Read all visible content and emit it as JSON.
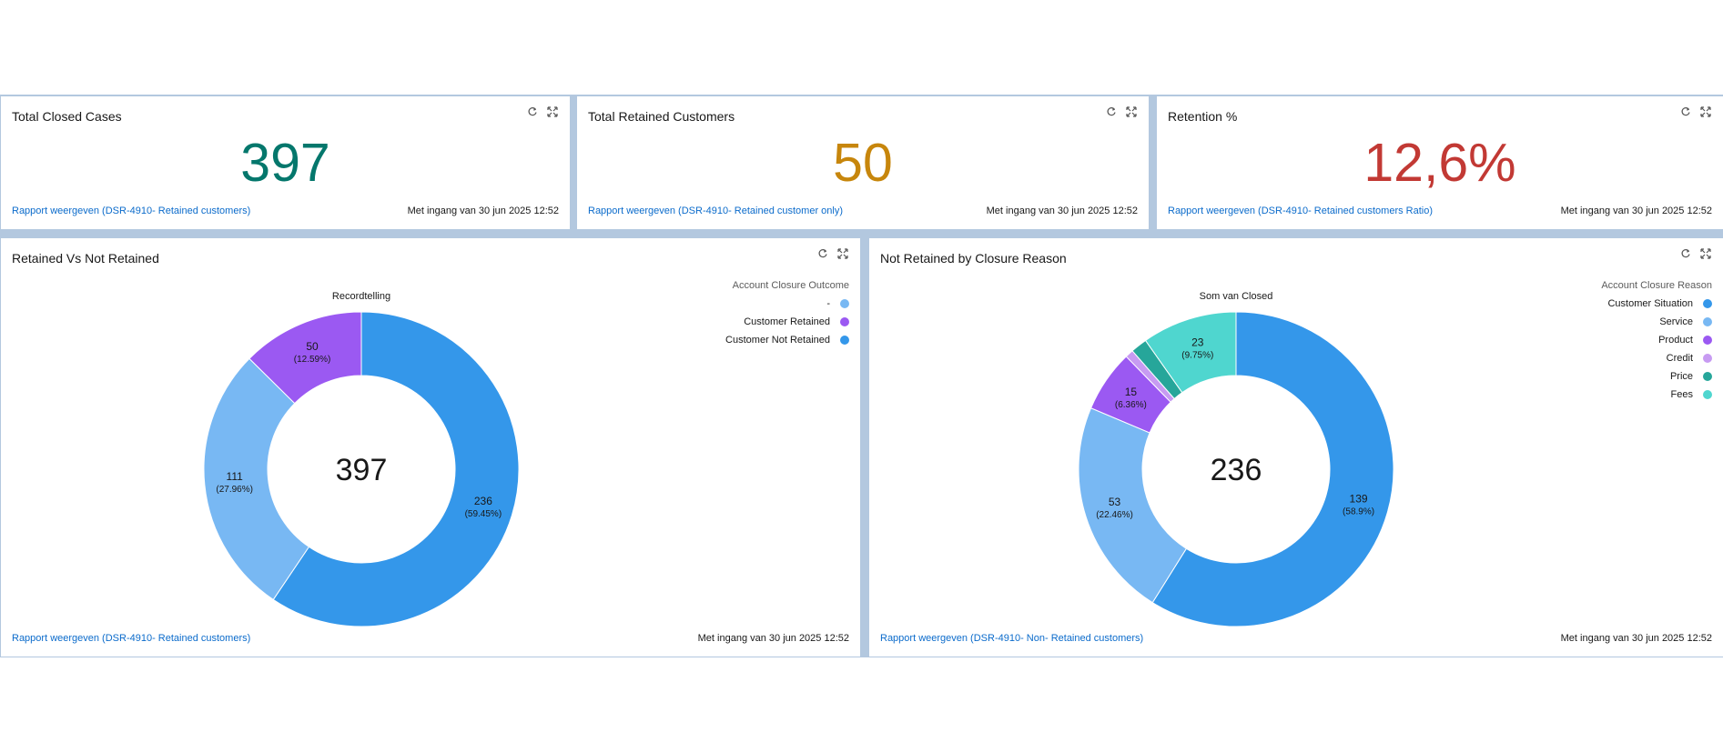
{
  "cards": {
    "closed": {
      "title": "Total Closed Cases",
      "value": "397",
      "value_color": "#04776c",
      "link": "Rapport weergeven (DSR-4910- Retained customers)",
      "asof": "Met ingang van 30 jun 2025 12:52"
    },
    "retained": {
      "title": "Total Retained Customers",
      "value": "50",
      "value_color": "#c7860c",
      "link": "Rapport weergeven (DSR-4910- Retained customer only)",
      "asof": "Met ingang van 30 jun 2025 12:52"
    },
    "ratio": {
      "title": "Retention %",
      "value": "12,6%",
      "value_color": "#c23934",
      "link": "Rapport weergeven (DSR-4910- Retained customers Ratio)",
      "asof": "Met ingang van 30 jun 2025 12:52"
    },
    "retained_chart": {
      "title": "Retained Vs Not Retained",
      "link": "Rapport weergeven (DSR-4910- Retained customers)",
      "asof": "Met ingang van 30 jun 2025 12:52",
      "legend_title": "Account Closure Outcome"
    },
    "reason_chart": {
      "title": "Not Retained by Closure Reason",
      "link": "Rapport weergeven (DSR-4910- Non- Retained customers)",
      "asof": "Met ingang van 30 jun 2025 12:52",
      "legend_title": "Account Closure Reason"
    }
  },
  "icons": {
    "refresh": "refresh-icon",
    "expand": "expand-icon"
  },
  "chart_data": [
    {
      "type": "pie",
      "title": "Recordtelling",
      "center_total": "397",
      "legend_title": "Account Closure Outcome",
      "slices": [
        {
          "name": "Customer Not Retained",
          "value": 236,
          "label": "236",
          "pct": "(59.45%)",
          "color": "#3497ea"
        },
        {
          "name": "-",
          "value": 111,
          "label": "111",
          "pct": "(27.96%)",
          "color": "#78b8f3"
        },
        {
          "name": "Customer Retained",
          "value": 50,
          "label": "50",
          "pct": "(12.59%)",
          "color": "#9b59f2"
        }
      ],
      "legend_order": [
        "-",
        "Customer Retained",
        "Customer Not Retained"
      ]
    },
    {
      "type": "pie",
      "title": "Som van Closed",
      "center_total": "236",
      "legend_title": "Account Closure Reason",
      "slices": [
        {
          "name": "Customer Situation",
          "value": 139,
          "label": "139",
          "pct": "(58.9%)",
          "color": "#3497ea"
        },
        {
          "name": "Service",
          "value": 53,
          "label": "53",
          "pct": "(22.46%)",
          "color": "#78b8f3"
        },
        {
          "name": "Product",
          "value": 15,
          "label": "15",
          "pct": "(6.36%)",
          "color": "#9b59f2"
        },
        {
          "name": "Credit",
          "value": 2,
          "label": "",
          "pct": "",
          "color": "#c79bf2"
        },
        {
          "name": "Price",
          "value": 4,
          "label": "",
          "pct": "",
          "color": "#26a69a"
        },
        {
          "name": "Fees",
          "value": 23,
          "label": "23",
          "pct": "(9.75%)",
          "color": "#4fd6cf"
        }
      ],
      "legend_order": [
        "Customer Situation",
        "Service",
        "Product",
        "Credit",
        "Price",
        "Fees"
      ]
    }
  ]
}
